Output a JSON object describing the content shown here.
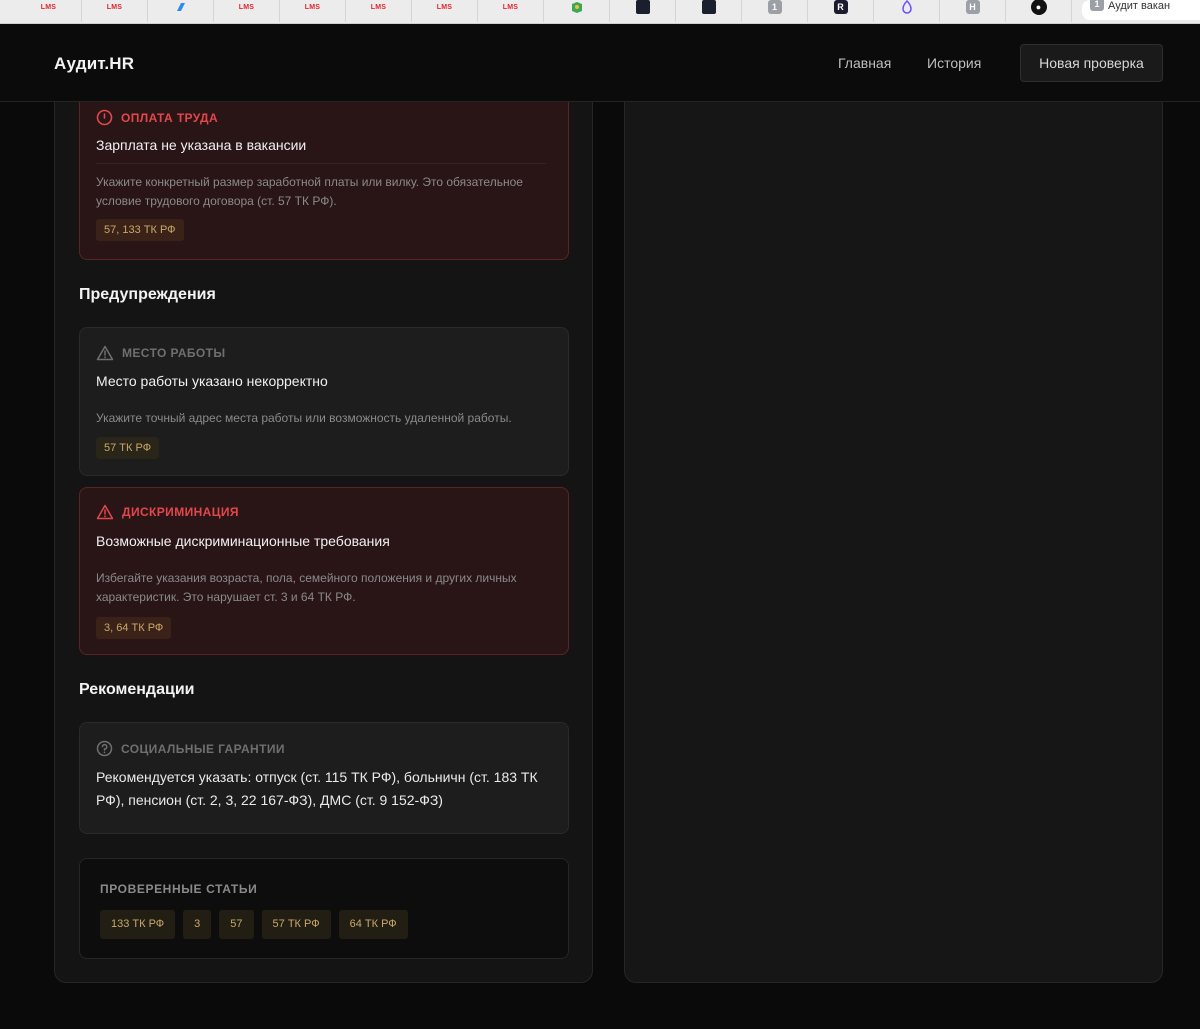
{
  "browser": {
    "tabs": [
      {
        "icon": "lms-icon",
        "label": "LMS"
      },
      {
        "icon": "lms-icon",
        "label": "LMS"
      },
      {
        "icon": "blue-app-icon",
        "label": ""
      },
      {
        "icon": "lms-icon",
        "label": "LMS"
      },
      {
        "icon": "lms-icon",
        "label": "LMS"
      },
      {
        "icon": "lms-icon",
        "label": "LMS"
      },
      {
        "icon": "lms-icon",
        "label": "LMS"
      },
      {
        "icon": "lms-icon",
        "label": "LMS"
      },
      {
        "icon": "map-icon",
        "label": ""
      },
      {
        "icon": "dark-app-icon",
        "label": ""
      },
      {
        "icon": "dark-app-icon",
        "label": ""
      },
      {
        "icon": "number-icon",
        "label": "1"
      },
      {
        "icon": "r-icon",
        "label": "R"
      },
      {
        "icon": "bubble-icon",
        "label": ""
      },
      {
        "icon": "h-icon",
        "label": "H"
      },
      {
        "icon": "github-icon",
        "label": ""
      }
    ],
    "active_tab": {
      "badge": "1",
      "title": "Аудит вакан"
    }
  },
  "header": {
    "logo": "Аудит.HR",
    "nav": {
      "home": "Главная",
      "history": "История"
    },
    "new_check": "Новая проверка"
  },
  "issues": {
    "pay": {
      "category": "ОПЛАТА ТРУДА",
      "title": "Зарплата не указана в вакансии",
      "text": "Укажите конкретный размер заработной платы или вилку. Это обязательное условие трудового договора (ст. 57 ТК РФ).",
      "tag": "57, 133 ТК РФ"
    }
  },
  "warnings": {
    "section_title": "Предупреждения",
    "workplace": {
      "category": "МЕСТО РАБОТЫ",
      "title": "Место работы указано некорректно",
      "text": "Укажите точный адрес места работы или возможность удаленной работы.",
      "tag": "57 ТК РФ"
    },
    "discrimination": {
      "category": "ДИСКРИМИНАЦИЯ",
      "title": "Возможные дискриминационные требования",
      "text": "Избегайте указания возраста, пола, семейного положения и других личных характеристик. Это нарушает ст. 3 и 64 ТК РФ.",
      "tag": "3, 64 ТК РФ"
    }
  },
  "recommendations": {
    "section_title": "Рекомендации",
    "social": {
      "category": "СОЦИАЛЬНЫЕ ГАРАНТИИ",
      "text": "Рекомендуется указать: отпуск (ст. 115 ТК РФ), больничн (ст. 183 ТК РФ), пенсион (ст. 2, 3, 22 167-ФЗ), ДМС (ст. 9 152-ФЗ)"
    }
  },
  "checked": {
    "title": "ПРОВЕРЕННЫЕ СТАТЬИ",
    "articles": [
      "133 ТК РФ",
      "3",
      "57",
      "57 ТК РФ",
      "64 ТК РФ"
    ]
  },
  "colors": {
    "accent_red": "#e2474c",
    "tag_gold": "#c9a86a",
    "background": "#0a0a0a"
  }
}
